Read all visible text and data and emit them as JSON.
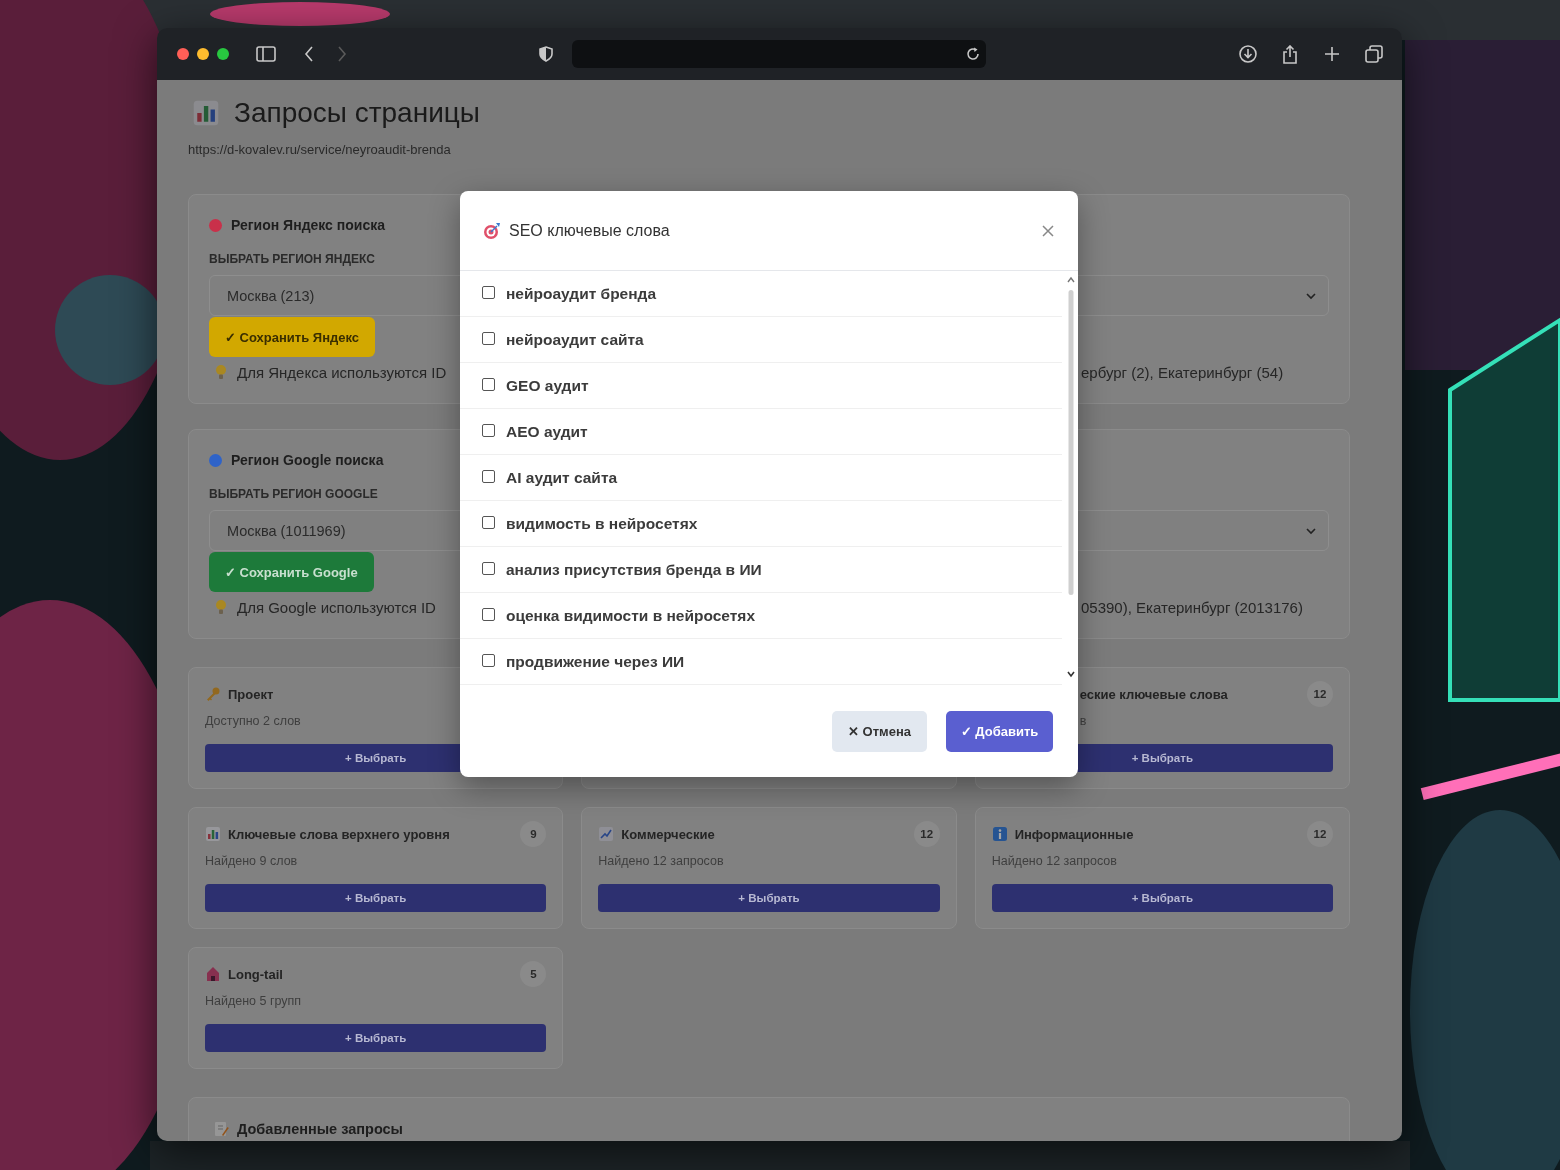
{
  "page": {
    "title": "Запросы страницы",
    "url": "https://d-kovalev.ru/service/neyroaudit-brenda"
  },
  "regions": [
    {
      "kind": "yandex",
      "title": "Регион Яндекс поиска",
      "color": "#c9304a",
      "label": "ВЫБРАТЬ РЕГИОН ЯНДЕКС",
      "value": "Москва (213)",
      "button": "✓ Сохранить Яндекс",
      "hint": "Для Яндекса используются ID",
      "hint_tail": "ербург (2), Екатеринбург (54)"
    },
    {
      "kind": "google",
      "title": "Регион Google поиска",
      "color": "#2f63c8",
      "label": "ВЫБРАТЬ РЕГИОН GOOGLE",
      "value": "Москва (1011969)",
      "button": "✓ Сохранить Google",
      "hint": "Для Google используются ID",
      "hint_tail": "05390), Екатеринбург (2013176)"
    }
  ],
  "groups": [
    {
      "kind": "full",
      "title": "Проект",
      "subtitle": "Доступно 2 слов",
      "button": "+ Выбрать"
    },
    {
      "kind": "covered"
    },
    {
      "kind": "partial",
      "title": "еские ключевые слова",
      "count": "12",
      "subtitle": "в",
      "button": "+ Выбрать"
    },
    {
      "kind": "full",
      "title": "Ключевые слова верхнего уровня",
      "count": "9",
      "subtitle": "Найдено 9 слов",
      "button": "+ Выбрать"
    },
    {
      "kind": "full",
      "title": "Коммерческие",
      "count": "12",
      "subtitle": "Найдено 12 запросов",
      "button": "+ Выбрать"
    },
    {
      "kind": "full",
      "title": "Информационные",
      "count": "12",
      "subtitle": "Найдено 12 запросов",
      "button": "+ Выбрать"
    },
    {
      "kind": "full",
      "title": "Long-tail",
      "count": "5",
      "subtitle": "Найдено 5 групп",
      "button": "+ Выбрать"
    }
  ],
  "added": {
    "title": "Добавленные запросы"
  },
  "modal": {
    "title": "SEO ключевые слова",
    "options": [
      {
        "label": "нейроаудит бренда",
        "checked": false
      },
      {
        "label": "нейроаудит сайта",
        "checked": false
      },
      {
        "label": "GEO аудит",
        "checked": false
      },
      {
        "label": "AEO аудит",
        "checked": false
      },
      {
        "label": "AI аудит сайта",
        "checked": false
      },
      {
        "label": "видимость в нейросетях",
        "checked": false
      },
      {
        "label": "анализ присутствия бренда в ИИ",
        "checked": false
      },
      {
        "label": "оценка видимости в нейросетях",
        "checked": false
      },
      {
        "label": "продвижение через ИИ",
        "checked": false
      }
    ],
    "cancel": "✕ Отмена",
    "submit": "✓ Добавить"
  }
}
